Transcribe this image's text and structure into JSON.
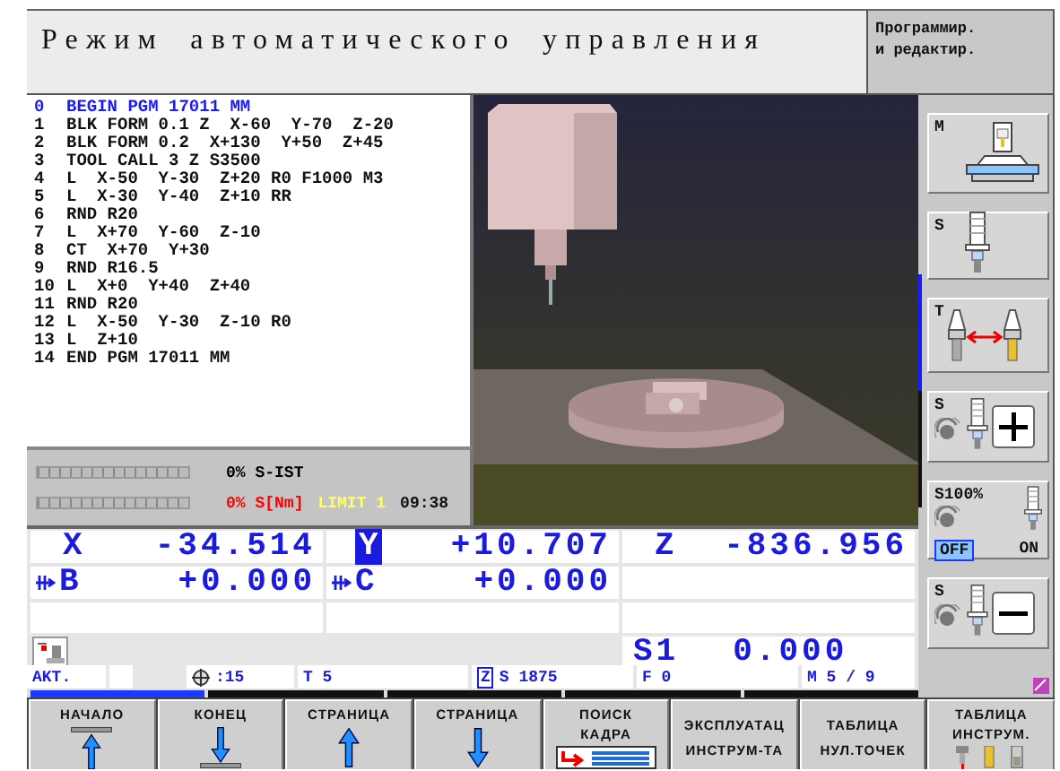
{
  "header": {
    "title": "Режим автоматического управления",
    "mode_lines": [
      "Программир.",
      "и редактир."
    ]
  },
  "program": {
    "lines": [
      {
        "number": "0",
        "text": "BEGIN PGM 17011 MM",
        "selected": true
      },
      {
        "number": "1",
        "text": "BLK FORM 0.1 Z  X-60  Y-70  Z-20",
        "selected": false
      },
      {
        "number": "2",
        "text": "BLK FORM 0.2  X+130  Y+50  Z+45",
        "selected": false
      },
      {
        "number": "3",
        "text": "TOOL CALL 3 Z S3500",
        "selected": false
      },
      {
        "number": "4",
        "text": "L  X-50  Y-30  Z+20 R0 F1000 M3",
        "selected": false
      },
      {
        "number": "5",
        "text": "L  X-30  Y-40  Z+10 RR",
        "selected": false
      },
      {
        "number": "6",
        "text": "RND R20",
        "selected": false
      },
      {
        "number": "7",
        "text": "L  X+70  Y-60  Z-10",
        "selected": false
      },
      {
        "number": "8",
        "text": "CT  X+70  Y+30",
        "selected": false
      },
      {
        "number": "9",
        "text": "RND R16.5",
        "selected": false
      },
      {
        "number": "10",
        "text": "L  X+0  Y+40  Z+40",
        "selected": false
      },
      {
        "number": "11",
        "text": "RND R20",
        "selected": false
      },
      {
        "number": "12",
        "text": "L  X-50  Y-30  Z-10 R0",
        "selected": false
      },
      {
        "number": "13",
        "text": "L  Z+10",
        "selected": false
      },
      {
        "number": "14",
        "text": "END PGM 17011 MM",
        "selected": false
      }
    ]
  },
  "gauges": [
    {
      "level": 0,
      "reading": "0%",
      "label": "S-IST",
      "alert": false
    },
    {
      "level": 0,
      "reading": "0%",
      "label": "S[Nm]",
      "alert": true
    }
  ],
  "limit": "LIMIT 1",
  "time": "09:38",
  "position_rows": [
    [
      {
        "axis": "X",
        "value": "-34.514",
        "selected": false,
        "rotary": false
      },
      {
        "axis": "Y",
        "value": "+10.707",
        "selected": true,
        "rotary": false
      },
      {
        "axis": "Z",
        "value": "-836.956",
        "selected": false,
        "rotary": false
      }
    ],
    [
      {
        "axis": "B",
        "value": "+0.000",
        "selected": false,
        "rotary": true
      },
      {
        "axis": "C",
        "value": "+0.000",
        "selected": false,
        "rotary": true
      }
    ]
  ],
  "spindle_readout": {
    "label": "S1",
    "value": "0.000"
  },
  "status_fields": [
    {
      "kind": "text",
      "text": "AKT."
    },
    {
      "kind": "blank"
    },
    {
      "kind": "datum",
      "text": ":15"
    },
    {
      "kind": "text",
      "text": "T 5"
    },
    {
      "kind": "axis",
      "axis": "Z",
      "text": "S 1875"
    },
    {
      "kind": "text",
      "text": "F 0"
    },
    {
      "kind": "text",
      "text": "M 5 / 9"
    }
  ],
  "softkey_pages": [
    {
      "selected": true
    },
    {
      "selected": false
    },
    {
      "selected": false
    },
    {
      "selected": false
    },
    {
      "selected": false
    }
  ],
  "side_pages": [
    {
      "selected": true
    },
    {
      "selected": false
    }
  ],
  "side_keys": [
    {
      "kind": "machine",
      "label": "M"
    },
    {
      "kind": "spindle",
      "label": "S"
    },
    {
      "kind": "tool-change",
      "label": "T"
    },
    {
      "kind": "spindle-plus",
      "label": "S"
    },
    {
      "kind": "override",
      "label": "S100%",
      "options": [
        {
          "label": "OFF",
          "selected": true
        },
        {
          "label": "ON",
          "selected": false
        }
      ]
    },
    {
      "kind": "spindle-minus",
      "label": "S"
    }
  ],
  "softkeys": [
    {
      "lines": [
        "НАЧАЛО"
      ],
      "kind": "start"
    },
    {
      "lines": [
        "КОНЕЦ"
      ],
      "kind": "end"
    },
    {
      "lines": [
        "СТРАНИЦА"
      ],
      "kind": "up"
    },
    {
      "lines": [
        "СТРАНИЦА"
      ],
      "kind": "down"
    },
    {
      "lines": [
        "ПОИСК",
        "КАДРА"
      ],
      "kind": "search"
    },
    {
      "lines": [
        "ЭКСПЛУАТАЦ",
        "ИНСТРУМ-ТА"
      ],
      "kind": "text"
    },
    {
      "lines": [
        "ТАБЛИЦА",
        "НУЛ.ТОЧЕК"
      ],
      "kind": "text"
    },
    {
      "lines": [
        "ТАБЛИЦА",
        "ИНСТРУМ."
      ],
      "kind": "tools"
    }
  ]
}
